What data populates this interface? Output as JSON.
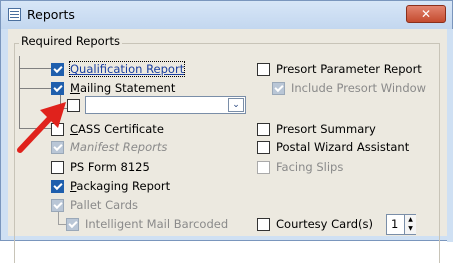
{
  "window": {
    "title": "Reports",
    "close_glyph": "✕"
  },
  "group": {
    "label": "Required Reports"
  },
  "mailing_dropdown": {
    "value": "",
    "arrow_glyph": "⌄"
  },
  "left_items": [
    {
      "label": "Qualification Report",
      "checked": true,
      "enabled": true
    },
    {
      "label": "Mailing Statement",
      "checked": true,
      "enabled": true
    },
    {
      "label": "",
      "checked": false,
      "enabled": true
    },
    {
      "label": "CASS Certificate",
      "checked": false,
      "enabled": true
    },
    {
      "label": "Manifest Reports",
      "checked": true,
      "enabled": false
    },
    {
      "label": "PS Form 8125",
      "checked": false,
      "enabled": true
    },
    {
      "label": "Packaging Report",
      "checked": true,
      "enabled": true
    },
    {
      "label": "Pallet Cards",
      "checked": true,
      "enabled": false
    },
    {
      "label": "Intelligent Mail Barcoded",
      "checked": true,
      "enabled": false
    }
  ],
  "right_items": [
    {
      "label": "Presort Parameter Report",
      "checked": false,
      "enabled": true
    },
    {
      "label": "Include Presort Window",
      "checked": true,
      "enabled": false
    },
    {
      "label": "Presort Summary",
      "checked": false,
      "enabled": true
    },
    {
      "label": "Postal Wizard Assistant",
      "checked": false,
      "enabled": true
    },
    {
      "label": "Facing Slips",
      "checked": false,
      "enabled": false
    },
    {
      "label": "Courtesy Card(s)",
      "checked": false,
      "enabled": true
    }
  ],
  "courtesy_count": {
    "value": "1",
    "up_glyph": "▲",
    "down_glyph": "▼"
  },
  "colors": {
    "accent": "#1f5fad",
    "arrow": "#e0221c"
  }
}
